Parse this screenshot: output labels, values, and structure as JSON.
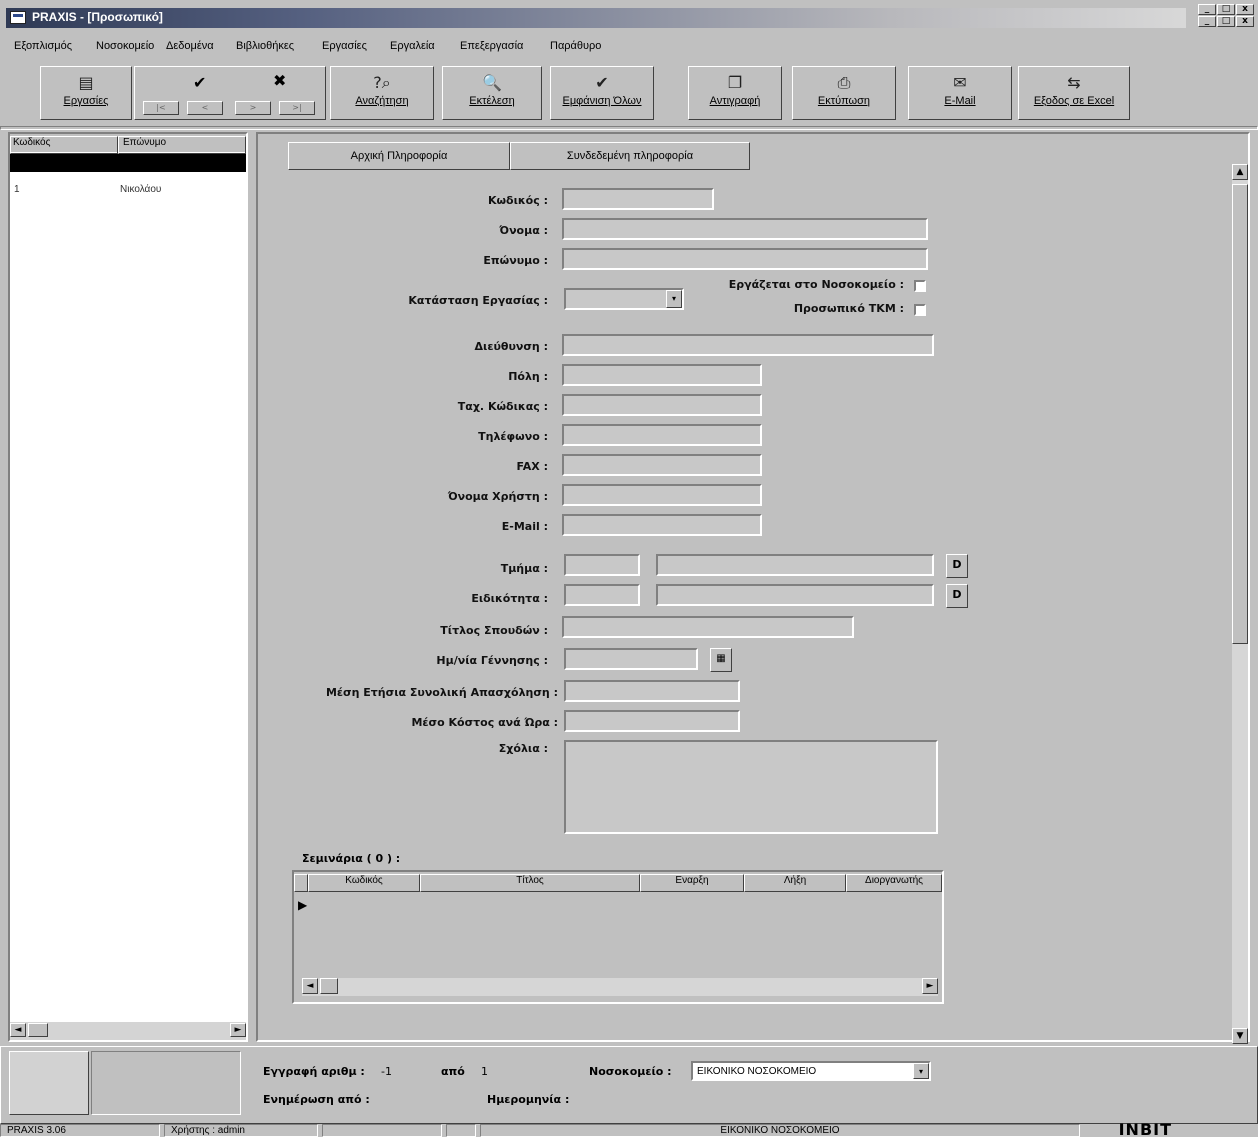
{
  "window": {
    "title": "PRAXIS - [Προσωπικό]",
    "controls": {
      "minimize": "_",
      "maximize": "□",
      "close": "x"
    }
  },
  "menu": [
    "Εξοπλισμός",
    "Νοσοκομείο",
    "Δεδομένα",
    "Βιβλιοθήκες",
    "Εργασίες",
    "Εργαλεία",
    "Επεξεργασία",
    "Παράθυρο"
  ],
  "toolbar": {
    "tasks": "Εργασίες",
    "search": "Αναζήτηση",
    "execute": "Εκτέλεση",
    "show_all": "Εμφάνιση Όλων",
    "copy": "Αντιγραφή",
    "print": "Εκτύπωση",
    "email": "E-Mail",
    "export_excel": "Εξοδος σε Excel",
    "nav": [
      "|<",
      "<",
      ">",
      ">|"
    ]
  },
  "left_grid": {
    "columns": [
      "Κωδικός",
      "Επώνυμο"
    ],
    "rows": [
      {
        "code": "1",
        "surname": "Νικολάου"
      }
    ]
  },
  "tabs": [
    "Αρχική Πληροφορία",
    "Συνδεδεμένη πληροφορία"
  ],
  "form": {
    "code_label": "Κωδικός :",
    "name_label": "Όνομα :",
    "surname_label": "Επώνυμο :",
    "works_in_hospital_label": "Εργάζεται στο Νοσοκομείο :",
    "tkm_staff_label": "Προσωπικό ΤΚΜ :",
    "work_status_label": "Κατάσταση Εργασίας :",
    "address_label": "Διεύθυνση :",
    "city_label": "Πόλη :",
    "postal_code_label": "Ταχ. Κώδικας :",
    "phone_label": "Τηλέφωνο :",
    "fax_label": "FAX :",
    "username_label": "Όνομα Χρήστη :",
    "email_label": "E-Mail :",
    "department_label": "Τμήμα :",
    "specialty_label": "Ειδικότητα :",
    "degree_label": "Τίτλος Σπουδών :",
    "birthdate_label": "Ημ/νία Γέννησης :",
    "avg_employment_label": "Μέση Ετήσια Συνολική Απασχόληση :",
    "avg_hourly_cost_label": "Μέσο Κόστος ανά Ώρα :",
    "comments_label": "Σχόλια :",
    "lookup_glyph": "D",
    "dropdown_glyph": "▾",
    "calendar_glyph": "▦"
  },
  "seminars": {
    "title": "Σεμινάρια ( 0 ) :",
    "columns": [
      "Κωδικός",
      "Τίτλος",
      "Εναρξη",
      "Λήξη",
      "Διοργανωτής"
    ]
  },
  "bottom": {
    "record_label": "Εγγραφή αριθμ :",
    "record_value": "-1",
    "of_label": "από",
    "of_value": "1",
    "hospital_label": "Νοσοκομείο :",
    "hospital_value": "ΕΙΚΟΝΙΚΟ ΝΟΣΟΚΟΜΕΙΟ",
    "updated_by_label": "Ενημέρωση από :",
    "date_label": "Ημερομηνία :"
  },
  "statusbar": {
    "version": "PRAXIS 3.06",
    "user": "Χρήστης : admin",
    "hospital": "ΕΙΚΟΝΙΚΟ ΝΟΣΟΚΟΜΕΙΟ",
    "brand": "INBIT"
  }
}
